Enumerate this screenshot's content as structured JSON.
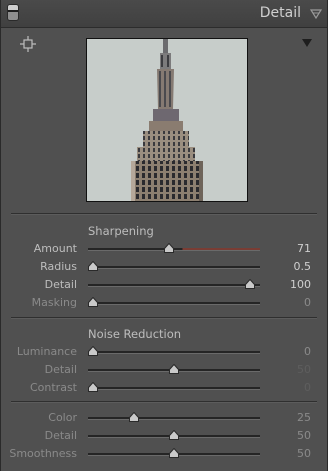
{
  "header": {
    "title": "Detail"
  },
  "sharpening": {
    "title": "Sharpening",
    "sliders": [
      {
        "label": "Amount",
        "value": "71",
        "fraction": 0.47
      },
      {
        "label": "Radius",
        "value": "0.5",
        "fraction": 0.0
      },
      {
        "label": "Detail",
        "value": "100",
        "fraction": 0.97
      },
      {
        "label": "Masking",
        "value": "0",
        "fraction": 0.0
      }
    ]
  },
  "noise_reduction": {
    "title": "Noise Reduction",
    "luminance_sliders": [
      {
        "label": "Luminance",
        "value": "0",
        "fraction": 0.0
      },
      {
        "label": "Detail",
        "value": "50",
        "fraction": 0.5
      },
      {
        "label": "Contrast",
        "value": "0",
        "fraction": 0.0
      }
    ],
    "color_sliders": [
      {
        "label": "Color",
        "value": "25",
        "fraction": 0.25
      },
      {
        "label": "Detail",
        "value": "50",
        "fraction": 0.5
      },
      {
        "label": "Smoothness",
        "value": "50",
        "fraction": 0.5
      }
    ]
  },
  "colors": {
    "panel": "#505050",
    "track": "#252525",
    "amount_tint": "#7a3d34"
  },
  "icons": {
    "collapse": "panel-collapse-icon",
    "menu": "triangle-down-icon",
    "target": "crosshair-icon",
    "preview_menu": "triangle-down-icon"
  }
}
